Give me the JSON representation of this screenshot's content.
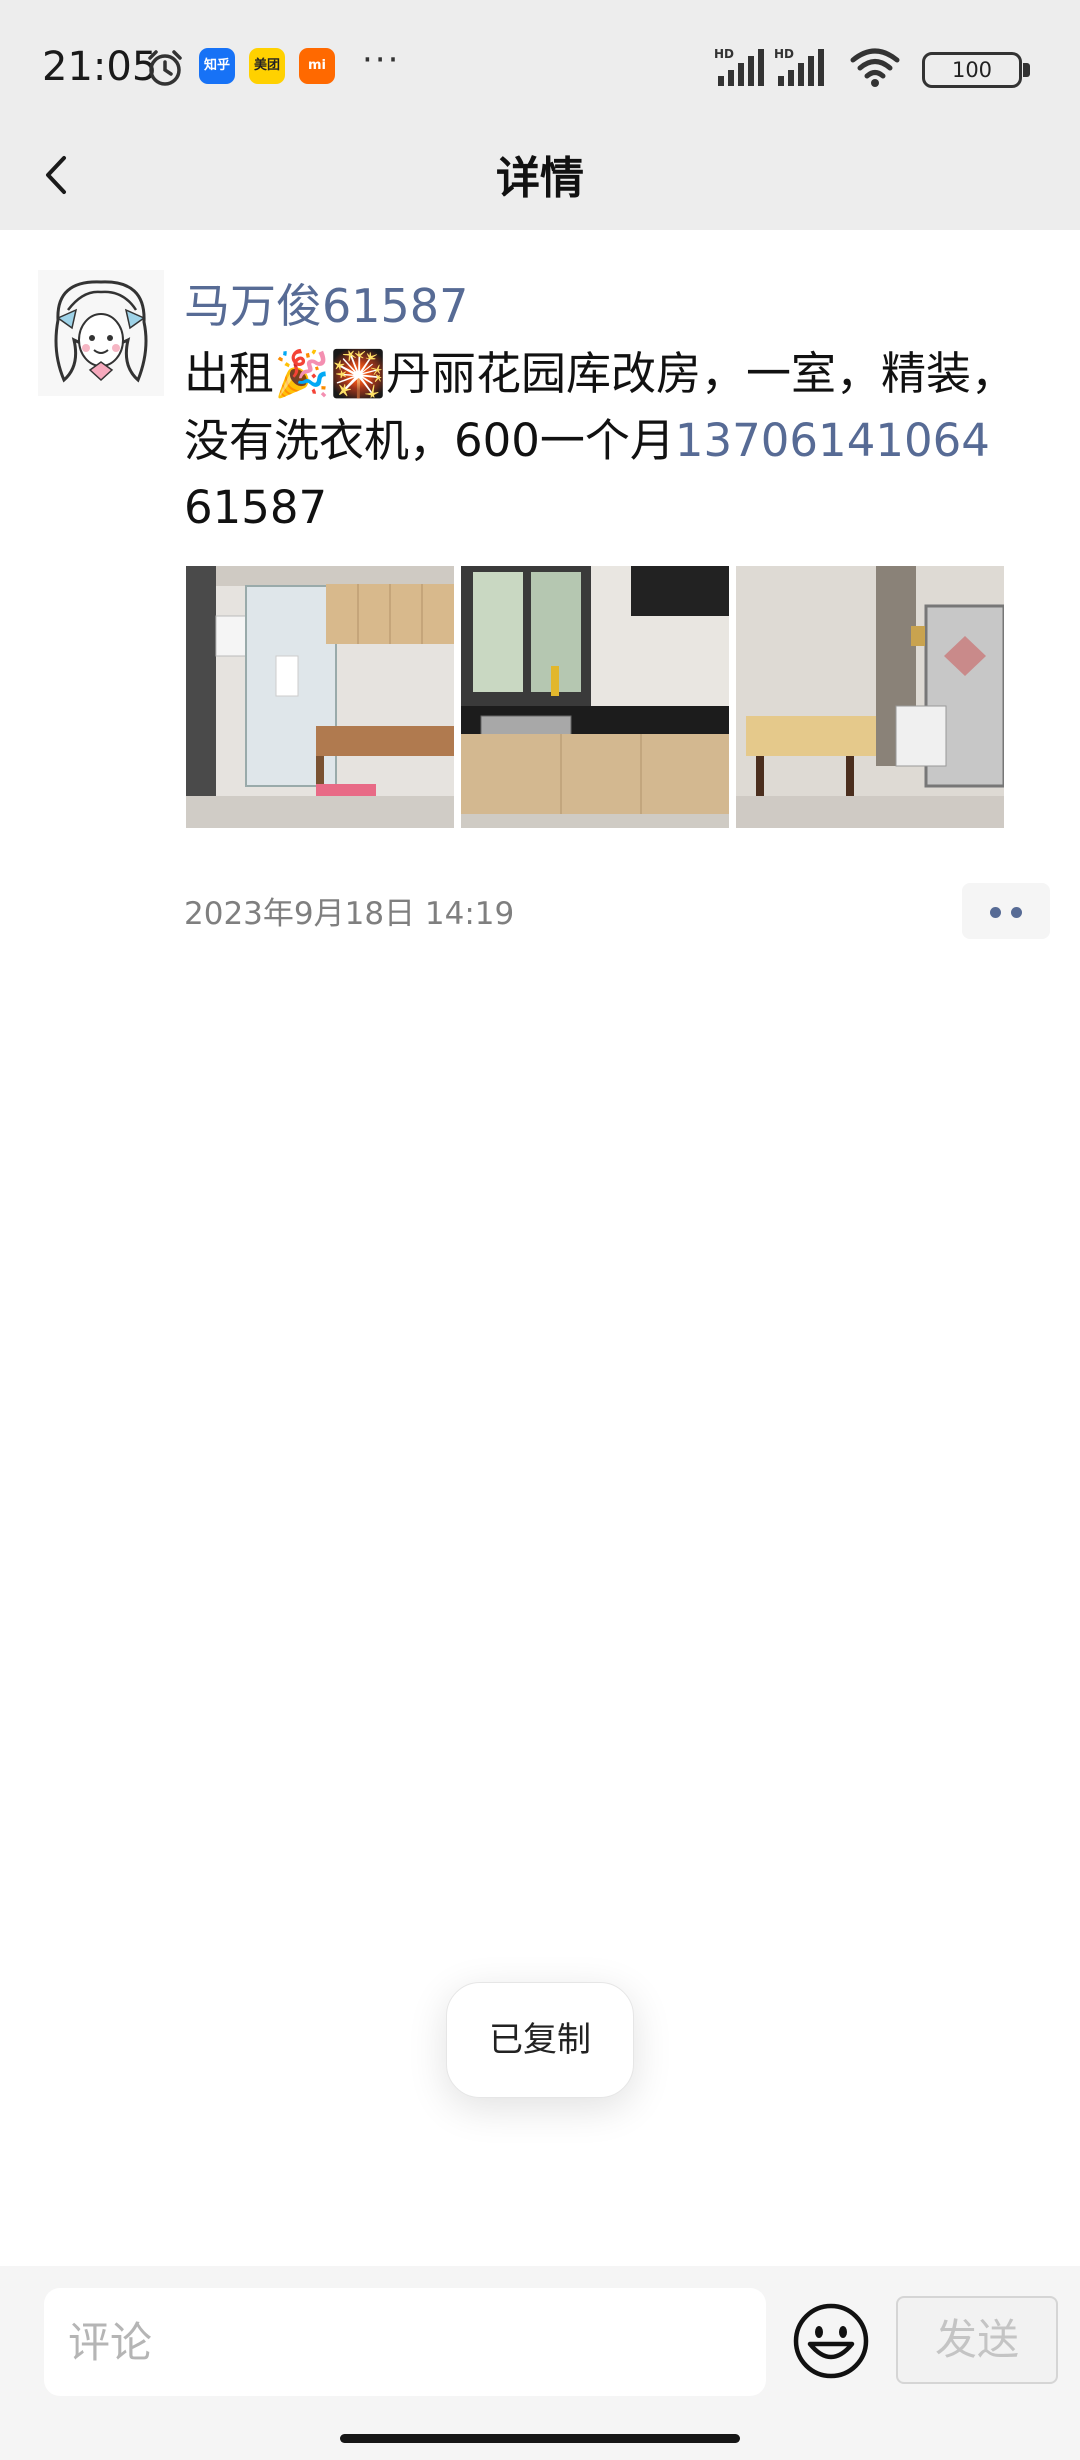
{
  "status_bar": {
    "time": "21:05",
    "apps": [
      "知乎",
      "美团",
      "mi"
    ],
    "more": "···",
    "battery": "100",
    "signal_label": "HD",
    "icons": [
      "alarm-icon",
      "signal-icon",
      "wifi-icon",
      "battery-icon"
    ]
  },
  "nav": {
    "title": "详情",
    "back_icon": "chevron-left-icon"
  },
  "post": {
    "author": "马万俊61587",
    "text_before_phone": "出租🎉🎇丹丽花园库改房，一室，精装，没有洗衣机，600一个月",
    "phone": "13706141064",
    "text_after_phone": "61587",
    "photos": [
      "bathroom-photo",
      "kitchen-photo",
      "dining-photo"
    ],
    "timestamp": "2023年9月18日 14:19",
    "more_icon": "two-dots-icon"
  },
  "toast": {
    "text": "已复制"
  },
  "comment_bar": {
    "placeholder": "评论",
    "value": "",
    "emoji_icon": "smiley-icon",
    "send_label": "发送"
  },
  "colors": {
    "link": "#576b95",
    "header_bg": "#ededed",
    "bottom_bar_bg": "#f5f5f5"
  }
}
